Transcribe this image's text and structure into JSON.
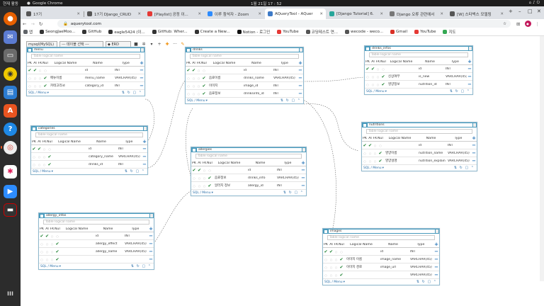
{
  "os": {
    "activities": "현재 활동",
    "app_name": "Google Chrome",
    "clock": "1월 21일  17 : 52"
  },
  "browser": {
    "tabs": [
      {
        "label": "17기",
        "color": "#555"
      },
      {
        "label": "17기 DJango_CRUD",
        "color": "#555"
      },
      {
        "label": "[Playlist] 공정 이...",
        "color": "#e53935"
      },
      {
        "label": "이루 참석자 - Zoom",
        "color": "#2d8cff"
      },
      {
        "label": "AQueryTool - AQuer",
        "color": "#3d7ac7"
      },
      {
        "label": "[Django Tutorial] 6.",
        "color": "#26a69a"
      },
      {
        "label": "Django 오류 관련에서",
        "color": "#777"
      },
      {
        "label": "[W] 스타벅스 모델링",
        "color": "#555"
      }
    ],
    "url": "aquerytool.com",
    "bookmarks": [
      {
        "label": "앱",
        "color": "#5f6368"
      },
      {
        "label": "SeongJaeMoo...",
        "color": "#333"
      },
      {
        "label": "GitHub",
        "color": "#333"
      },
      {
        "label": "eagle5424 (이...",
        "color": "#333"
      },
      {
        "label": "GitHub: Wher...",
        "color": "#333"
      },
      {
        "label": "Create a New...",
        "color": "#333"
      },
      {
        "label": "Notion - 로그인",
        "color": "#333"
      },
      {
        "label": "YouTube",
        "color": "#e53935"
      },
      {
        "label": "코딩테스트 연...",
        "color": "#333"
      },
      {
        "label": "wecode - weco...",
        "color": "#333"
      },
      {
        "label": "Gmail",
        "color": "#d93025"
      },
      {
        "label": "YouTube",
        "color": "#e53935"
      },
      {
        "label": "지도",
        "color": "#34a853"
      }
    ]
  },
  "toolbar": {
    "db": "mysql(MySQL)",
    "db_select": "--- 데이블 선택 ---",
    "mode": "ERD"
  },
  "columns": {
    "pk": "PK",
    "ai": "AI",
    "fk": "FK",
    "null": "Null",
    "logical": "Logical Name",
    "name": "Name",
    "type": "Type"
  },
  "placeholder": "Table logical name",
  "footer": "SQL / Menu",
  "tables": {
    "menu": {
      "title": "menu",
      "rows": [
        {
          "logical": "",
          "name": "id",
          "type": "INT"
        },
        {
          "logical": "메뉴이름",
          "name": "menu_name",
          "type": "VARCHAR(45)"
        },
        {
          "logical": "카테고리id",
          "name": "category_id",
          "type": "INT"
        }
      ]
    },
    "categories": {
      "title": "categories",
      "rows": [
        {
          "logical": "",
          "name": "id",
          "type": "INT"
        },
        {
          "logical": "",
          "name": "category_name",
          "type": "VARCHAR(45)"
        },
        {
          "logical": "",
          "name": "drinks_id",
          "type": "INT"
        }
      ]
    },
    "drinks": {
      "title": "drinks",
      "rows": [
        {
          "logical": "",
          "name": "id",
          "type": "INT"
        },
        {
          "logical": "음료이름",
          "name": "drinks_name",
          "type": "VARCHAR(45)"
        },
        {
          "logical": "이미지",
          "name": "image_id",
          "type": "INT"
        },
        {
          "logical": "음료정보",
          "name": "drinksinfo_id",
          "type": "INT"
        }
      ]
    },
    "drinks_infos": {
      "title": "drinks_infos",
      "rows": [
        {
          "logical": "",
          "name": "id",
          "type": "INT"
        },
        {
          "logical": "신상여부",
          "name": "is_new",
          "type": "VARCHAR(45)"
        },
        {
          "logical": "영양정보",
          "name": "nutrition_id",
          "type": "INT"
        }
      ]
    },
    "nutritions": {
      "title": "nutritions",
      "rows": [
        {
          "logical": "",
          "name": "id",
          "type": "INT"
        },
        {
          "logical": "영양이름",
          "name": "nutrition_name",
          "type": "VARCHAR(45)"
        },
        {
          "logical": "영양설명",
          "name": "nutrition_explain",
          "type": "VARCHAR(45)"
        }
      ]
    },
    "allergies": {
      "title": "allergies",
      "rows": [
        {
          "logical": "",
          "name": "id",
          "type": "INT"
        },
        {
          "logical": "음료정보",
          "name": "drinks_info",
          "type": "VARCHAR(45)"
        },
        {
          "logical": "알러지 정보",
          "name": "allergy_id",
          "type": "INT"
        }
      ]
    },
    "allergy_infos": {
      "title": "allergy_infos",
      "rows": [
        {
          "logical": "",
          "name": "id",
          "type": "INT"
        },
        {
          "logical": "",
          "name": "allergy_effect",
          "type": "VARCHAR(45)"
        },
        {
          "logical": "",
          "name": "allergy_name",
          "type": "VARCHAR(45)"
        },
        {
          "logical": "",
          "name": "",
          "type": ""
        }
      ]
    },
    "images": {
      "title": "images",
      "rows": [
        {
          "logical": "",
          "name": "id",
          "type": "INT"
        },
        {
          "logical": "이미지 이름",
          "name": "image_name",
          "type": "VARCHAR(45)"
        },
        {
          "logical": "이미지 경로",
          "name": "image_url",
          "type": "VARCHAR(45)"
        },
        {
          "logical": "",
          "name": "",
          "type": "VARCHAR(45)"
        }
      ]
    }
  }
}
